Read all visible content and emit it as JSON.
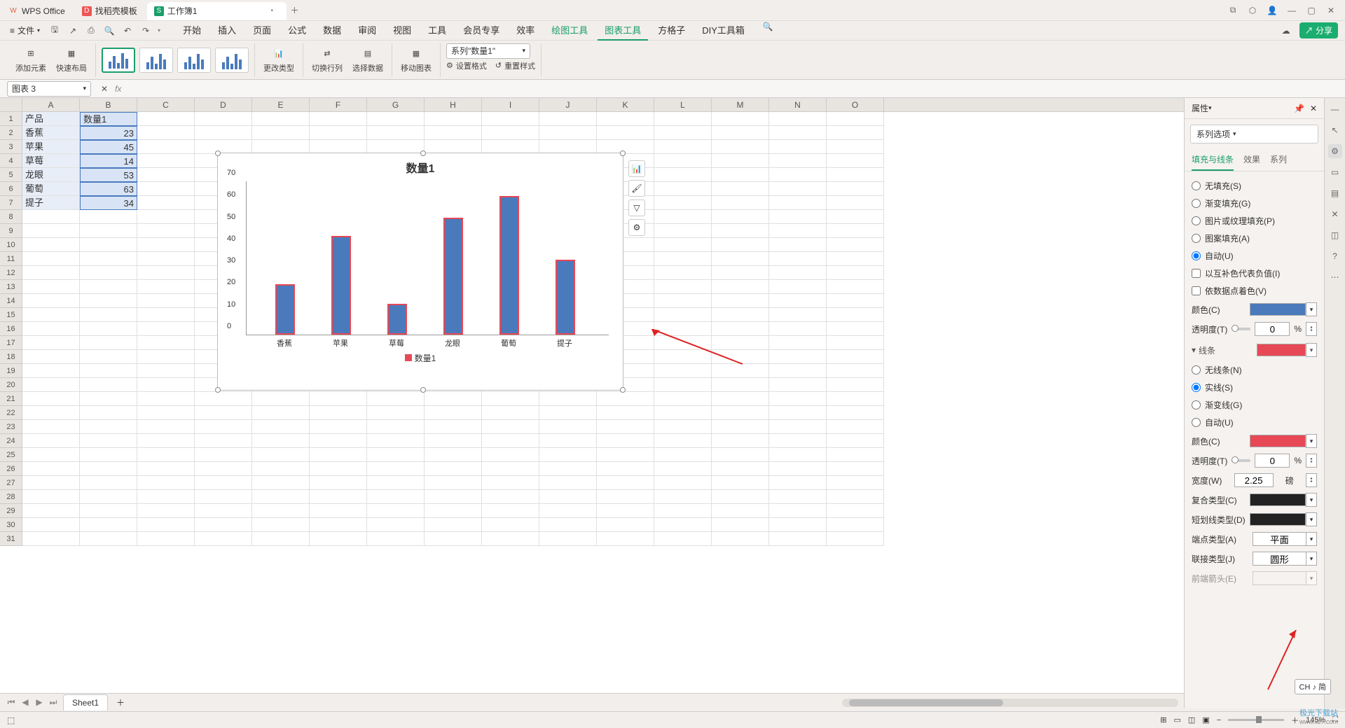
{
  "titlebar": {
    "tab1": "WPS Office",
    "tab2": "找稻壳模板",
    "tab3": "工作簿1"
  },
  "menubar": {
    "file": "文件",
    "items": [
      "开始",
      "插入",
      "页面",
      "公式",
      "数据",
      "审阅",
      "视图",
      "工具",
      "会员专享",
      "效率",
      "绘图工具",
      "图表工具",
      "方格子",
      "DIY工具箱"
    ],
    "share": "分享"
  },
  "ribbon": {
    "add_element": "添加元素",
    "quick_layout": "快速布局",
    "change_type": "更改类型",
    "switch_rc": "切换行列",
    "select_data": "选择数据",
    "move_chart": "移动图表",
    "series_select": "系列\"数量1\"",
    "set_format": "设置格式",
    "reset_style": "重置样式"
  },
  "namebox": "图表 3",
  "sheet": {
    "cols": [
      "A",
      "B",
      "C",
      "D",
      "E",
      "F",
      "G",
      "H",
      "I",
      "J",
      "K",
      "L",
      "M",
      "N",
      "O"
    ],
    "a1": "产品",
    "b1": "数量1",
    "a2": "香蕉",
    "b2": "23",
    "a3": "苹果",
    "b3": "45",
    "a4": "草莓",
    "b4": "14",
    "a5": "龙眼",
    "b5": "53",
    "a6": "葡萄",
    "b6": "63",
    "a7": "提子",
    "b7": "34"
  },
  "chart_data": {
    "type": "bar",
    "title": "数量1",
    "categories": [
      "香蕉",
      "苹果",
      "草莓",
      "龙眼",
      "葡萄",
      "提子"
    ],
    "values": [
      23,
      45,
      14,
      53,
      63,
      34
    ],
    "ylim": [
      0,
      70
    ],
    "yticks": [
      0,
      10,
      20,
      30,
      40,
      50,
      60,
      70
    ],
    "legend": "数量1"
  },
  "props": {
    "title": "属性",
    "series_options": "系列选项",
    "tabs": {
      "fill": "填充与线条",
      "effect": "效果",
      "series": "系列"
    },
    "fill_section": {
      "no_fill": "无填充(S)",
      "gradient": "渐变填充(G)",
      "picture": "图片或纹理填充(P)",
      "pattern": "图案填充(A)",
      "auto": "自动(U)",
      "invert_neg": "以互补色代表负值(I)",
      "vary_colors": "依数据点着色(V)",
      "color": "颜色(C)",
      "transparency": "透明度(T)",
      "transparency_val": "0",
      "pct": "%"
    },
    "line_section": {
      "header": "线条",
      "no_line": "无线条(N)",
      "solid": "实线(S)",
      "gradient_line": "渐变线(G)",
      "auto_line": "自动(U)",
      "color": "颜色(C)",
      "transparency": "透明度(T)",
      "transparency_val": "0",
      "pct": "%",
      "width": "宽度(W)",
      "width_val": "2.25",
      "width_unit": "磅",
      "compound": "复合类型(C)",
      "dash": "短划线类型(D)",
      "cap": "端点类型(A)",
      "cap_val": "平面",
      "join": "联接类型(J)",
      "join_val": "圆形",
      "arrow_start": "前端箭头(E)"
    }
  },
  "sheet_tab": "Sheet1",
  "zoom": "145%",
  "ime": "CH ♪ 简",
  "watermark": {
    "brand": "极光下载站",
    "url": "www.xz7.com"
  }
}
